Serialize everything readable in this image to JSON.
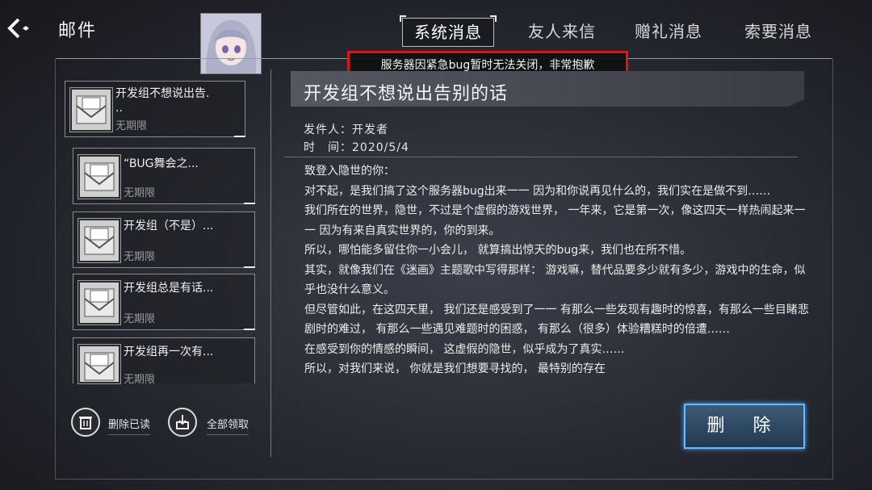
{
  "header": {
    "title": "邮件"
  },
  "tabs": [
    "系统消息",
    "友人来信",
    "赠礼消息",
    "索要消息"
  ],
  "notice": "服务器因紧急bug暂时无法关闭，非常抱歉",
  "mail_list": [
    {
      "subject": "开发组不想说出告.\n..",
      "expiry": "无期限"
    },
    {
      "subject": "“BUG舞会之...",
      "expiry": "无期限"
    },
    {
      "subject": "开发组（不是）...",
      "expiry": "无期限"
    },
    {
      "subject": "开发组总是有话...",
      "expiry": "无期限"
    },
    {
      "subject": "开发组再一次有...",
      "expiry": "无期限"
    }
  ],
  "actions": {
    "delete_read": "删除已读",
    "claim_all": "全部领取"
  },
  "mail": {
    "subject": "开发组不想说出告别的话",
    "sender_label": "发件人：",
    "sender": "开发者",
    "time_label": "时　间：",
    "time": "2020/5/4",
    "body": [
      "致登入隐世的你：",
      "对不起，是我们搞了这个服务器bug出来一一 因为和你说再见什么的，我们实在是做不到……",
      "我们所在的世界，隐世，不过是个虚假的游戏世界， 一年来，它是第一次，像这四天一样热闹起来一一 因为有来自真实世界的，你的到来。",
      "所以，哪怕能多留住你一小会儿， 就算搞出惊天的bug来，我们也在所不惜。",
      "其实，就像我们在《迷画》主题歌中写得那样： 游戏嘛，替代品要多少就有多少，游戏中的生命，似乎也没什么意义。",
      "但尽管如此，在这四天里， 我们还是感受到了一一 有那么一些发现有趣时的惊喜，有那么一些目睹悲剧时的难过， 有那么一些遇见难题时的困惑， 有那么（很多）体验糟糕时的倍遭……",
      "在感受到你的情感的瞬间， 这虚假的隐世，似乎成为了真实……",
      "所以，对我们来说， 你就是我们想要寻找的， 最特别的存在"
    ]
  },
  "delete_button": "删 除"
}
